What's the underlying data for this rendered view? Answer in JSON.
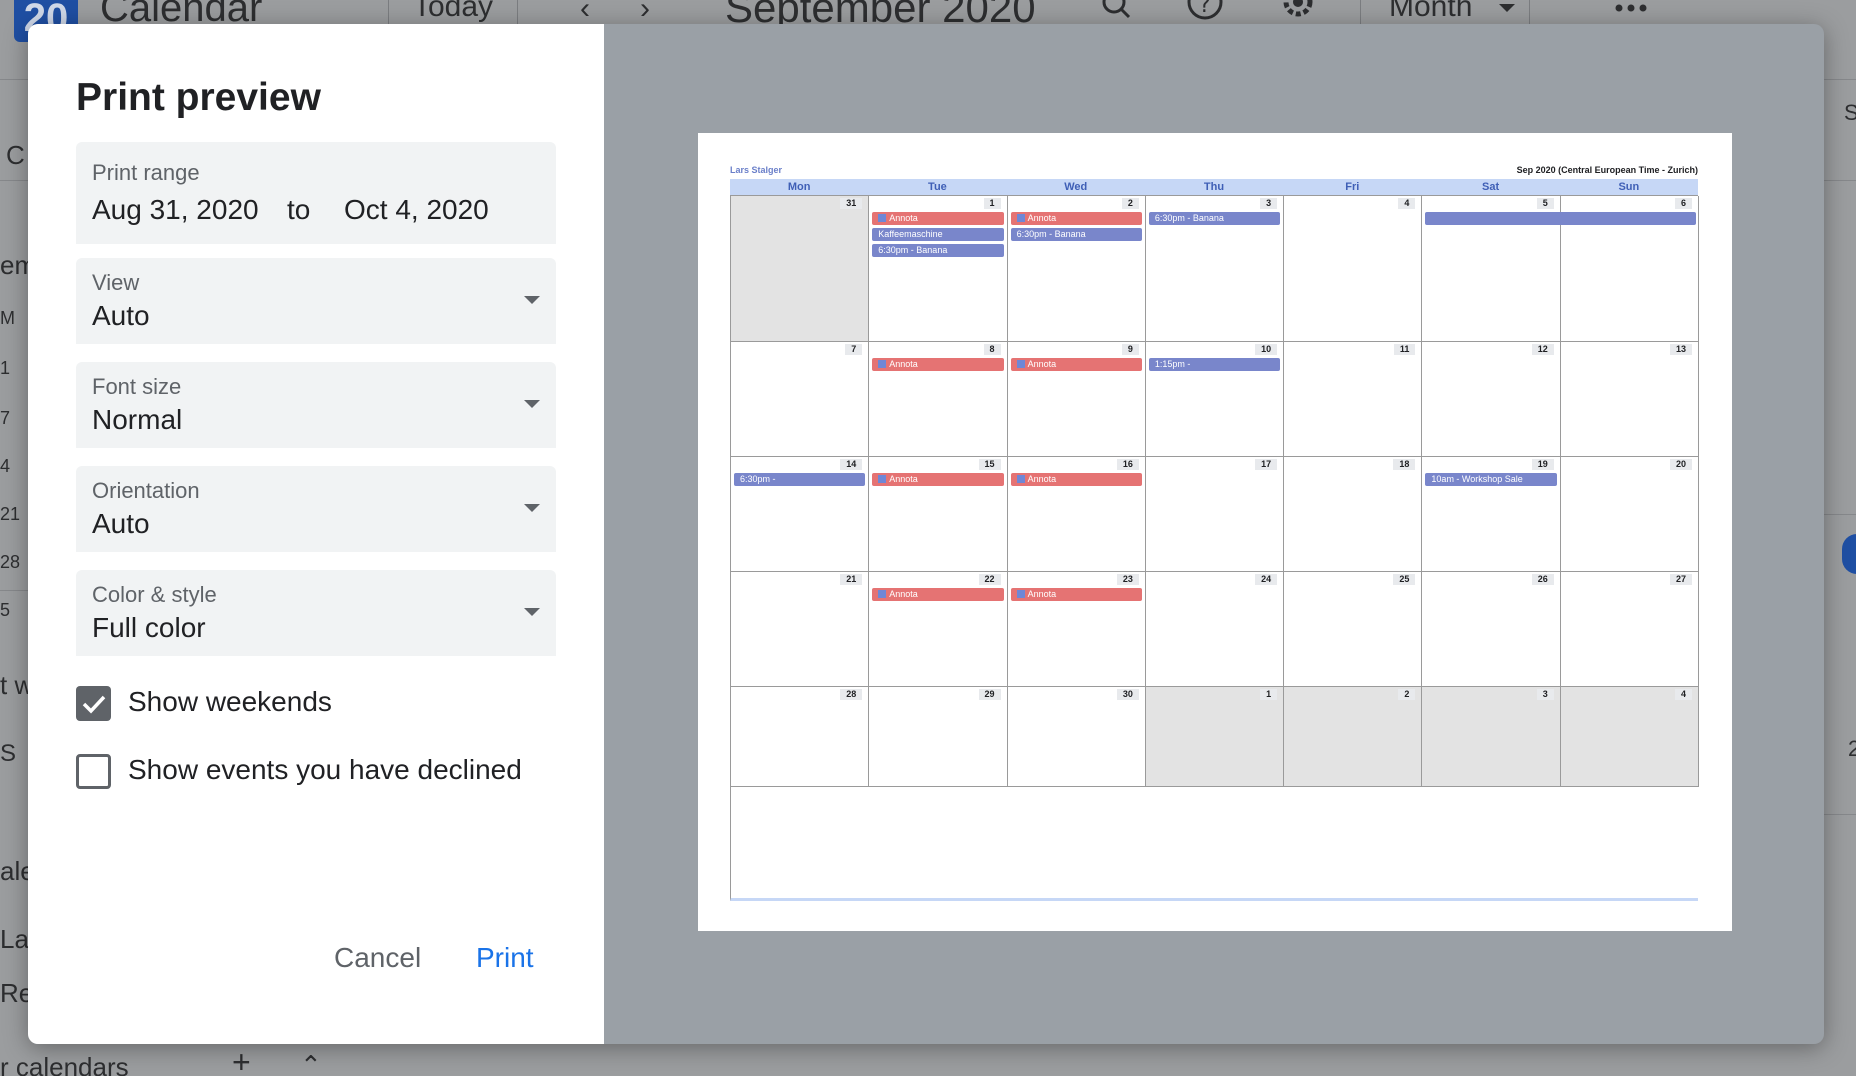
{
  "app": {
    "logo_day": "20",
    "name": "Calendar",
    "today_label": "Today",
    "title": "September 2020",
    "view_label": "Month",
    "side_fragments": [
      "C",
      "em",
      "M",
      "1",
      "7",
      "4",
      "21",
      "28",
      "5",
      "t w",
      "S",
      "ale",
      "Lar",
      "Rer",
      "r calendars",
      "S",
      "2"
    ]
  },
  "dialog": {
    "title": "Print preview",
    "print_range": {
      "label": "Print range",
      "start": "Aug 31, 2020",
      "to": "to",
      "end": "Oct 4, 2020"
    },
    "view": {
      "label": "View",
      "value": "Auto"
    },
    "font_size": {
      "label": "Font size",
      "value": "Normal"
    },
    "orientation": {
      "label": "Orientation",
      "value": "Auto"
    },
    "color_style": {
      "label": "Color & style",
      "value": "Full color"
    },
    "show_weekends": {
      "label": "Show weekends",
      "checked": true
    },
    "show_declined": {
      "label": "Show events you have declined",
      "checked": false
    },
    "cancel_label": "Cancel",
    "print_label": "Print"
  },
  "preview": {
    "owner": "Lars Stalger",
    "timezone": "Sep 2020 (Central European Time - Zurich)",
    "days_of_week": [
      "Mon",
      "Tue",
      "Wed",
      "Thu",
      "Fri",
      "Sat",
      "Sun"
    ],
    "weeks": [
      [
        {
          "num": "31",
          "other": true,
          "events": []
        },
        {
          "num": "1",
          "events": [
            {
              "text": "Annota",
              "color": "red",
              "dot": true
            },
            {
              "text": "Kaffeemaschine",
              "color": "blue"
            },
            {
              "text": "6:30pm - Banana",
              "color": "blue"
            }
          ]
        },
        {
          "num": "2",
          "events": [
            {
              "text": "Annota",
              "color": "red",
              "dot": true
            },
            {
              "text": "6:30pm - Banana",
              "color": "blue"
            }
          ]
        },
        {
          "num": "3",
          "events": [
            {
              "text": "6:30pm - Banana",
              "color": "blue"
            }
          ]
        },
        {
          "num": "4",
          "events": []
        },
        {
          "num": "5",
          "events": [
            {
              "text": "",
              "color": "blue",
              "span": 2
            }
          ]
        },
        {
          "num": "6",
          "events": []
        }
      ],
      [
        {
          "num": "7",
          "events": []
        },
        {
          "num": "8",
          "events": [
            {
              "text": "Annota",
              "color": "red",
              "dot": true
            }
          ]
        },
        {
          "num": "9",
          "events": [
            {
              "text": "Annota",
              "color": "red",
              "dot": true
            }
          ]
        },
        {
          "num": "10",
          "events": [
            {
              "text": "1:15pm -",
              "color": "blue"
            }
          ]
        },
        {
          "num": "11",
          "events": []
        },
        {
          "num": "12",
          "events": []
        },
        {
          "num": "13",
          "events": []
        }
      ],
      [
        {
          "num": "14",
          "events": [
            {
              "text": "6:30pm -",
              "color": "blue"
            }
          ]
        },
        {
          "num": "15",
          "events": [
            {
              "text": "Annota",
              "color": "red",
              "dot": true
            }
          ]
        },
        {
          "num": "16",
          "events": [
            {
              "text": "Annota",
              "color": "red",
              "dot": true
            }
          ]
        },
        {
          "num": "17",
          "events": []
        },
        {
          "num": "18",
          "events": []
        },
        {
          "num": "19",
          "events": [
            {
              "text": "10am - Workshop Sale",
              "color": "blue"
            }
          ]
        },
        {
          "num": "20",
          "events": []
        }
      ],
      [
        {
          "num": "21",
          "events": []
        },
        {
          "num": "22",
          "events": [
            {
              "text": "Annota",
              "color": "red",
              "dot": true
            }
          ]
        },
        {
          "num": "23",
          "events": [
            {
              "text": "Annota",
              "color": "red",
              "dot": true
            }
          ]
        },
        {
          "num": "24",
          "events": []
        },
        {
          "num": "25",
          "events": []
        },
        {
          "num": "26",
          "events": []
        },
        {
          "num": "27",
          "events": []
        }
      ],
      [
        {
          "num": "28",
          "events": []
        },
        {
          "num": "29",
          "events": []
        },
        {
          "num": "30",
          "events": []
        },
        {
          "num": "1",
          "other": true,
          "events": []
        },
        {
          "num": "2",
          "other": true,
          "events": []
        },
        {
          "num": "3",
          "other": true,
          "events": []
        },
        {
          "num": "4",
          "other": true,
          "events": []
        }
      ]
    ]
  },
  "colors": {
    "accent": "#1a73e8",
    "event_red": "#e57373",
    "event_blue": "#7986cb",
    "header_bar": "#c6d7f6"
  }
}
